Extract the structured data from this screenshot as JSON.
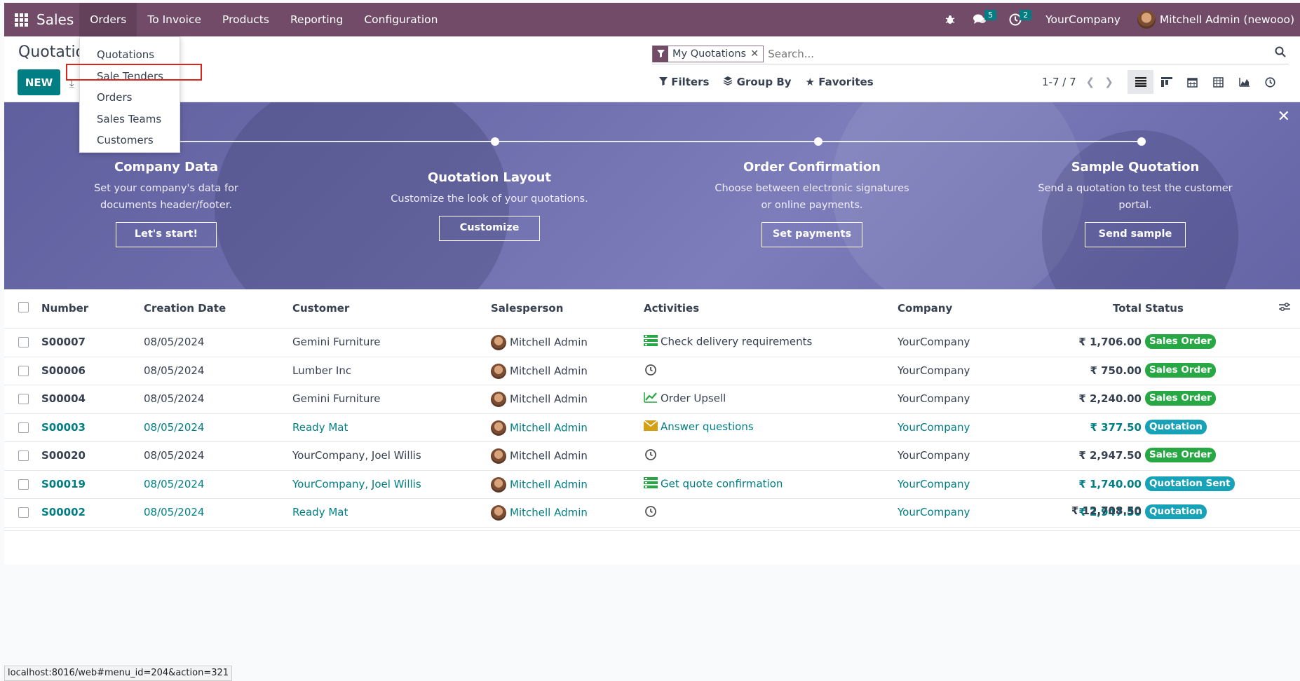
{
  "navbar": {
    "brand": "Sales",
    "menus": [
      "Orders",
      "To Invoice",
      "Products",
      "Reporting",
      "Configuration"
    ],
    "messages_count": "5",
    "activities_count": "2",
    "company": "YourCompany",
    "user": "Mitchell Admin (newooo)"
  },
  "orders_menu": [
    "Quotations",
    "Sale Tenders",
    "Orders",
    "Sales Teams",
    "Customers"
  ],
  "control": {
    "title": "Quotations",
    "new_label": "NEW",
    "facet": "My Quotations",
    "search_placeholder": "Search...",
    "filters": "Filters",
    "group_by": "Group By",
    "favorites": "Favorites",
    "pager": "1-7 / 7"
  },
  "banner": {
    "steps": [
      {
        "title": "Company Data",
        "desc": "Set your company's data for documents header/footer.",
        "button": "Let's start!"
      },
      {
        "title": "Quotation Layout",
        "desc": "Customize the look of your quotations.",
        "button": "Customize"
      },
      {
        "title": "Order Confirmation",
        "desc": "Choose between electronic signatures or online payments.",
        "button": "Set payments"
      },
      {
        "title": "Sample Quotation",
        "desc": "Send a quotation to test the customer portal.",
        "button": "Send sample"
      }
    ]
  },
  "table": {
    "headers": {
      "number": "Number",
      "date": "Creation Date",
      "customer": "Customer",
      "salesperson": "Salesperson",
      "activities": "Activities",
      "company": "Company",
      "total": "Total",
      "status": "Status"
    },
    "rows": [
      {
        "number": "S00007",
        "date": "08/05/2024",
        "customer": "Gemini Furniture",
        "salesperson": "Mitchell Admin",
        "activity": "Check delivery requirements",
        "activity_icon": "task-icon",
        "company": "YourCompany",
        "total": "₹ 1,706.00",
        "status": "Sales Order"
      },
      {
        "number": "S00006",
        "date": "08/05/2024",
        "customer": "Lumber Inc",
        "salesperson": "Mitchell Admin",
        "activity": "",
        "activity_icon": "clock-icon",
        "company": "YourCompany",
        "total": "₹ 750.00",
        "status": "Sales Order"
      },
      {
        "number": "S00004",
        "date": "08/05/2024",
        "customer": "Gemini Furniture",
        "salesperson": "Mitchell Admin",
        "activity": "Order Upsell",
        "activity_icon": "chart-icon",
        "company": "YourCompany",
        "total": "₹ 2,240.00",
        "status": "Sales Order"
      },
      {
        "number": "S00003",
        "date": "08/05/2024",
        "customer": "Ready Mat",
        "salesperson": "Mitchell Admin",
        "activity": "Answer questions",
        "activity_icon": "envelope-icon",
        "company": "YourCompany",
        "total": "₹ 377.50",
        "status": "Quotation"
      },
      {
        "number": "S00020",
        "date": "08/05/2024",
        "customer": "YourCompany, Joel Willis",
        "salesperson": "Mitchell Admin",
        "activity": "",
        "activity_icon": "clock-icon",
        "company": "YourCompany",
        "total": "₹ 2,947.50",
        "status": "Sales Order"
      },
      {
        "number": "S00019",
        "date": "08/05/2024",
        "customer": "YourCompany, Joel Willis",
        "salesperson": "Mitchell Admin",
        "activity": "Get quote confirmation",
        "activity_icon": "task-icon",
        "company": "YourCompany",
        "total": "₹ 1,740.00",
        "status": "Quotation Sent"
      },
      {
        "number": "S00002",
        "date": "08/05/2024",
        "customer": "Ready Mat",
        "salesperson": "Mitchell Admin",
        "activity": "",
        "activity_icon": "clock-icon",
        "company": "YourCompany",
        "total": "₹ 2,947.50",
        "status": "Quotation"
      }
    ],
    "grand_total": "₹ 12,708.50"
  },
  "statusbar": "localhost:8016/web#menu_id=204&action=321",
  "colors": {
    "brand": "#714b67",
    "accent": "#017e84",
    "status_green": "#28a745",
    "status_teal": "#17a2b8",
    "highlight": "#d9251c"
  }
}
